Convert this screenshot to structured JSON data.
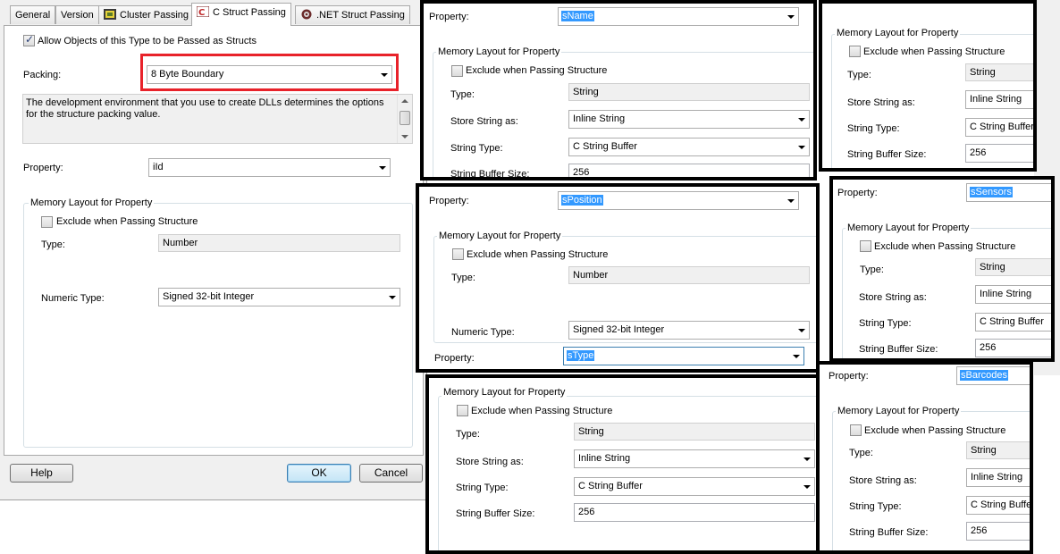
{
  "tabs": [
    {
      "label": "General"
    },
    {
      "label": "Version"
    },
    {
      "label": "Cluster Passing"
    },
    {
      "label": "C Struct Passing"
    },
    {
      "label": ".NET Struct Passing"
    }
  ],
  "dialog": {
    "allow_label": "Allow Objects of this Type to be Passed as Structs",
    "packing_label": "Packing:",
    "packing_value": "8 Byte Boundary",
    "description": "The development environment that you use to create DLLs determines the options for the structure packing value.",
    "property_label": "Property:",
    "property_value": "iId",
    "group_title": "Memory Layout for Property",
    "exclude_label": "Exclude when Passing Structure",
    "type_label": "Type:",
    "type_value": "Number",
    "numeric_type_label": "Numeric Type:",
    "numeric_type_value": "Signed 32-bit Integer",
    "help": "Help",
    "ok": "OK",
    "cancel": "Cancel"
  },
  "labels": {
    "property": "Property:",
    "memory_layout": "Memory Layout for Property",
    "exclude": "Exclude when Passing Structure",
    "type": "Type:",
    "store_as": "Store String as:",
    "string_type": "String Type:",
    "buffer_size": "String Buffer Size:",
    "numeric_type": "Numeric Type:"
  },
  "panels": {
    "sname": {
      "property": "sName",
      "type": "String",
      "store_as": "Inline String",
      "string_type": "C String Buffer",
      "buffer_size": "256"
    },
    "sposition": {
      "property": "sPosition",
      "type": "Number",
      "numeric_type": "Signed 32-bit Integer",
      "next_property": "sType"
    },
    "stype": {
      "type": "String",
      "store_as": "Inline String",
      "string_type": "C String Buffer",
      "buffer_size": "256"
    },
    "right_top": {
      "type": "String",
      "store_as": "Inline String",
      "string_type": "C String Buffer",
      "buffer_size": "256"
    },
    "ssensors": {
      "property": "sSensors",
      "type": "String",
      "store_as": "Inline String",
      "string_type": "C String Buffer",
      "buffer_size": "256"
    },
    "sbarcodes": {
      "property": "sBarcodes",
      "type": "String",
      "store_as": "Inline String",
      "string_type": "C String Buffer",
      "buffer_size": "256"
    }
  },
  "colors": {
    "highlight": "#e8222a",
    "selection": "#3399ff",
    "panel_border": "#000000"
  }
}
